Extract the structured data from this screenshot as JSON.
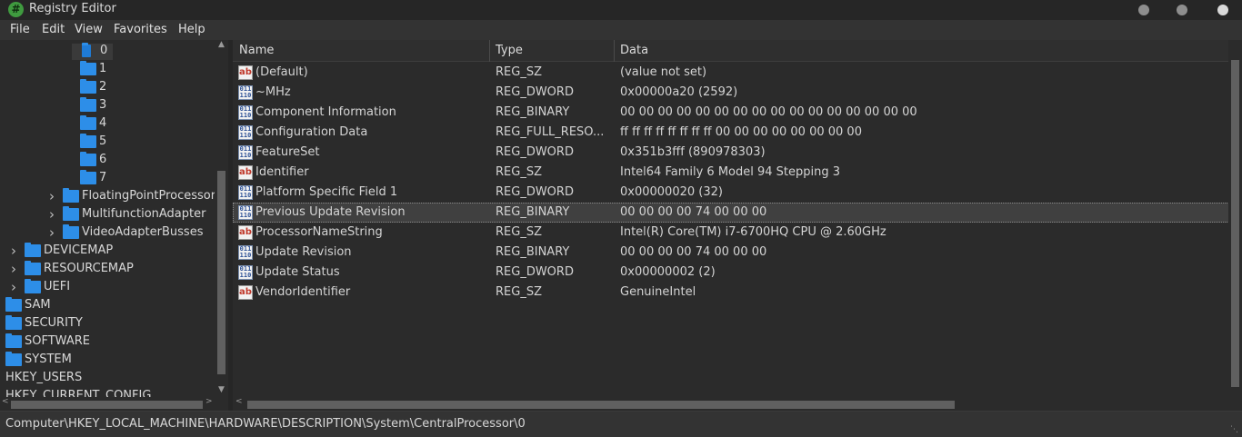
{
  "window": {
    "title": "Registry Editor"
  },
  "menu": [
    "File",
    "Edit",
    "View",
    "Favorites",
    "Help"
  ],
  "tree": [
    {
      "label": "0",
      "depth": 4,
      "selected": true,
      "expandable": false
    },
    {
      "label": "1",
      "depth": 4,
      "expandable": false
    },
    {
      "label": "2",
      "depth": 4,
      "expandable": false
    },
    {
      "label": "3",
      "depth": 4,
      "expandable": false
    },
    {
      "label": "4",
      "depth": 4,
      "expandable": false
    },
    {
      "label": "5",
      "depth": 4,
      "expandable": false
    },
    {
      "label": "6",
      "depth": 4,
      "expandable": false
    },
    {
      "label": "7",
      "depth": 4,
      "expandable": false
    },
    {
      "label": "FloatingPointProcessor",
      "depth": 3,
      "expandable": true
    },
    {
      "label": "MultifunctionAdapter",
      "depth": 3,
      "expandable": true
    },
    {
      "label": "VideoAdapterBusses",
      "depth": 3,
      "expandable": true
    },
    {
      "label": "DEVICEMAP",
      "depth": 1,
      "expandable": true
    },
    {
      "label": "RESOURCEMAP",
      "depth": 1,
      "expandable": true
    },
    {
      "label": "UEFI",
      "depth": 1,
      "expandable": true
    },
    {
      "label": "SAM",
      "depth": 0,
      "expandable": false
    },
    {
      "label": "SECURITY",
      "depth": 0,
      "expandable": false
    },
    {
      "label": "SOFTWARE",
      "depth": 0,
      "expandable": false
    },
    {
      "label": "SYSTEM",
      "depth": 0,
      "expandable": false
    },
    {
      "label": "HKEY_USERS",
      "depth": -1,
      "expandable": false
    },
    {
      "label": "HKEY_CURRENT_CONFIG",
      "depth": -1,
      "expandable": false
    }
  ],
  "list": {
    "columns": [
      "Name",
      "Type",
      "Data"
    ],
    "rows": [
      {
        "icon": "string-value-icon",
        "name": "(Default)",
        "type": "REG_SZ",
        "data": "(value not set)"
      },
      {
        "icon": "binary-value-icon",
        "name": "~MHz",
        "type": "REG_DWORD",
        "data": "0x00000a20 (2592)"
      },
      {
        "icon": "binary-value-icon",
        "name": "Component Information",
        "type": "REG_BINARY",
        "data": "00 00 00 00 00 00 00 00 00 00 00 00 00 00 00 00"
      },
      {
        "icon": "binary-value-icon",
        "name": "Configuration Data",
        "type": "REG_FULL_RESO...",
        "data": "ff ff ff ff ff ff ff ff 00 00 00 00 00 00 00 00"
      },
      {
        "icon": "binary-value-icon",
        "name": "FeatureSet",
        "type": "REG_DWORD",
        "data": "0x351b3fff (890978303)"
      },
      {
        "icon": "string-value-icon",
        "name": "Identifier",
        "type": "REG_SZ",
        "data": "Intel64 Family 6 Model 94 Stepping 3"
      },
      {
        "icon": "binary-value-icon",
        "name": "Platform Specific Field 1",
        "type": "REG_DWORD",
        "data": "0x00000020 (32)"
      },
      {
        "icon": "binary-value-icon",
        "name": "Previous Update Revision",
        "type": "REG_BINARY",
        "data": "00 00 00 00 74 00 00 00",
        "selected": true
      },
      {
        "icon": "string-value-icon",
        "name": "ProcessorNameString",
        "type": "REG_SZ",
        "data": "Intel(R) Core(TM) i7-6700HQ CPU @ 2.60GHz"
      },
      {
        "icon": "binary-value-icon",
        "name": "Update Revision",
        "type": "REG_BINARY",
        "data": "00 00 00 00 74 00 00 00"
      },
      {
        "icon": "binary-value-icon",
        "name": "Update Status",
        "type": "REG_DWORD",
        "data": "0x00000002 (2)"
      },
      {
        "icon": "string-value-icon",
        "name": "VendorIdentifier",
        "type": "REG_SZ",
        "data": "GenuineIntel"
      }
    ]
  },
  "status": {
    "path": "Computer\\HKEY_LOCAL_MACHINE\\HARDWARE\\DESCRIPTION\\System\\CentralProcessor\\0"
  },
  "icons": {
    "string": "ab",
    "binary": "011\n110"
  }
}
